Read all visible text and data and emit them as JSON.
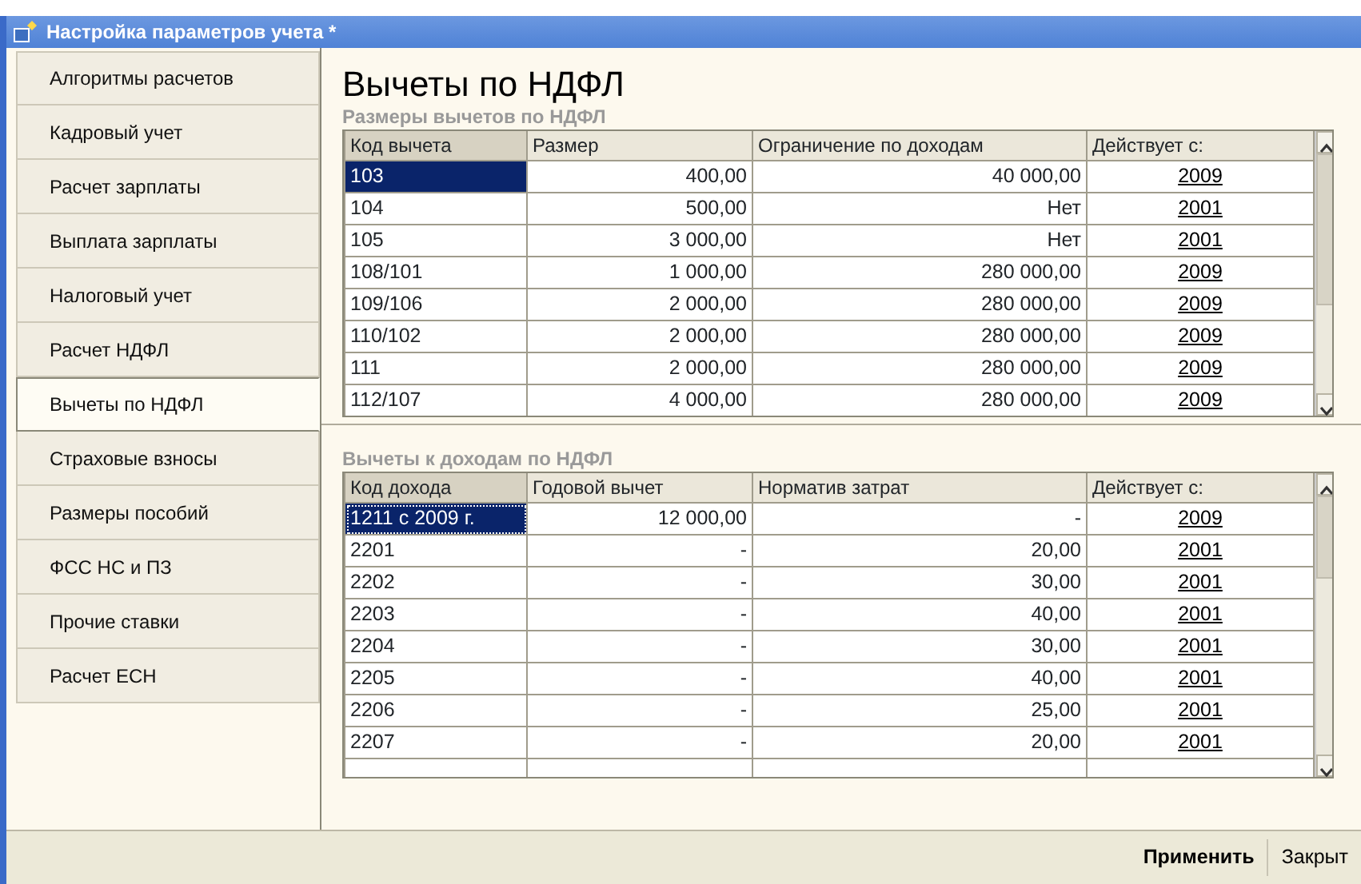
{
  "window": {
    "title": "Настройка параметров учета *"
  },
  "tabs": [
    {
      "label": "Алгоритмы расчетов",
      "selected": false
    },
    {
      "label": "Кадровый учет",
      "selected": false
    },
    {
      "label": "Расчет зарплаты",
      "selected": false
    },
    {
      "label": "Выплата зарплаты",
      "selected": false
    },
    {
      "label": "Налоговый учет",
      "selected": false
    },
    {
      "label": "Расчет НДФЛ",
      "selected": false
    },
    {
      "label": "Вычеты по НДФЛ",
      "selected": true
    },
    {
      "label": "Страховые взносы",
      "selected": false
    },
    {
      "label": "Размеры пособий",
      "selected": false
    },
    {
      "label": "ФСС НС и ПЗ",
      "selected": false
    },
    {
      "label": "Прочие ставки",
      "selected": false
    },
    {
      "label": "Расчет ЕСН",
      "selected": false
    }
  ],
  "heading": "Вычеты по НДФЛ",
  "sections": [
    {
      "title": "Размеры вычетов по НДФЛ",
      "columns": [
        "Код вычета",
        "Размер",
        "Ограничение по доходам",
        "Действует с:"
      ],
      "rows": [
        {
          "cells": [
            "103",
            "400,00",
            "40 000,00",
            "2009"
          ],
          "selected": true
        },
        {
          "cells": [
            "104",
            "500,00",
            "Нет",
            "2001"
          ],
          "selected": false
        },
        {
          "cells": [
            "105",
            "3 000,00",
            "Нет",
            "2001"
          ],
          "selected": false
        },
        {
          "cells": [
            "108/101",
            "1 000,00",
            "280 000,00",
            "2009"
          ],
          "selected": false
        },
        {
          "cells": [
            "109/106",
            "2 000,00",
            "280 000,00",
            "2009"
          ],
          "selected": false
        },
        {
          "cells": [
            "110/102",
            "2 000,00",
            "280 000,00",
            "2009"
          ],
          "selected": false
        },
        {
          "cells": [
            "111",
            "2 000,00",
            "280 000,00",
            "2009"
          ],
          "selected": false
        },
        {
          "cells": [
            "112/107",
            "4 000,00",
            "280 000,00",
            "2009"
          ],
          "selected": false
        }
      ]
    },
    {
      "title": "Вычеты к доходам по НДФЛ",
      "columns": [
        "Код дохода",
        "Годовой вычет",
        "Норматив затрат",
        "Действует с:"
      ],
      "rows": [
        {
          "cells": [
            "1211 с 2009 г.",
            "12 000,00",
            "-",
            "2009"
          ],
          "selected": true
        },
        {
          "cells": [
            "2201",
            "-",
            "20,00",
            "2001"
          ],
          "selected": false
        },
        {
          "cells": [
            "2202",
            "-",
            "30,00",
            "2001"
          ],
          "selected": false
        },
        {
          "cells": [
            "2203",
            "-",
            "40,00",
            "2001"
          ],
          "selected": false
        },
        {
          "cells": [
            "2204",
            "-",
            "30,00",
            "2001"
          ],
          "selected": false
        },
        {
          "cells": [
            "2205",
            "-",
            "40,00",
            "2001"
          ],
          "selected": false
        },
        {
          "cells": [
            "2206",
            "-",
            "25,00",
            "2001"
          ],
          "selected": false
        },
        {
          "cells": [
            "2207",
            "-",
            "20,00",
            "2001"
          ],
          "selected": false
        }
      ]
    }
  ],
  "buttons": [
    {
      "label": "Применить",
      "default": true
    },
    {
      "label": "Закрыт",
      "default": false
    }
  ]
}
